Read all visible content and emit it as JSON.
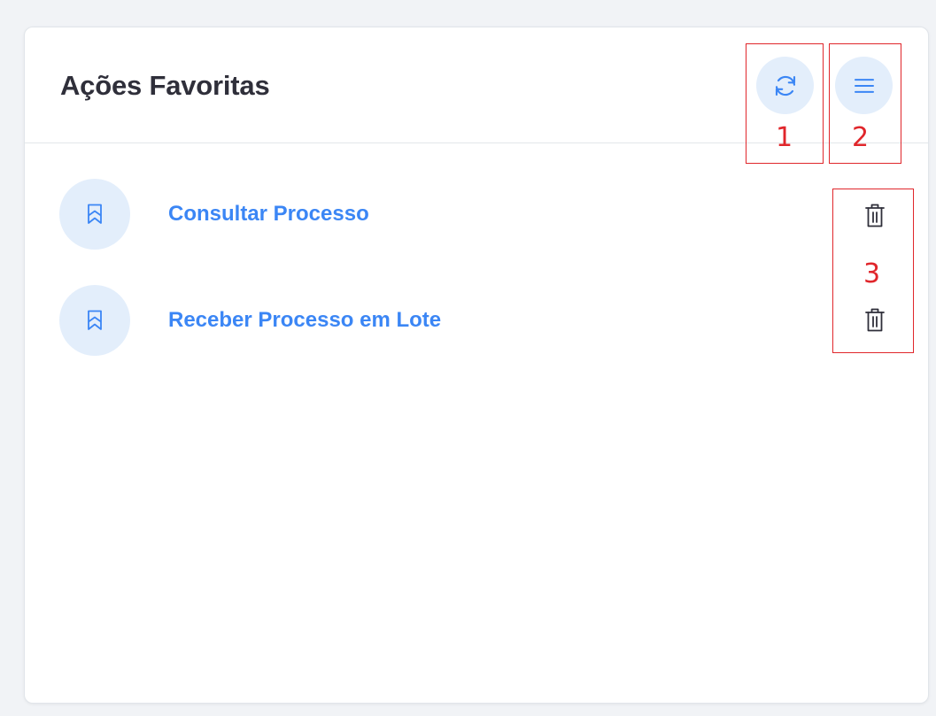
{
  "widget": {
    "title": "Ações Favoritas",
    "refresh_icon": "refresh-icon",
    "menu_icon": "hamburger-menu-icon"
  },
  "favorites": [
    {
      "label": "Consultar Processo",
      "icon": "bookmark-icon",
      "delete_icon": "trash-icon"
    },
    {
      "label": "Receber Processo em Lote",
      "icon": "bookmark-icon",
      "delete_icon": "trash-icon"
    }
  ],
  "annotations": [
    {
      "number": "1"
    },
    {
      "number": "2"
    },
    {
      "number": "3"
    }
  ],
  "colors": {
    "accent": "#3b86f5",
    "icon_bg": "#e3eefb",
    "annotation": "#e0262b",
    "title_text": "#2f2f3a"
  }
}
